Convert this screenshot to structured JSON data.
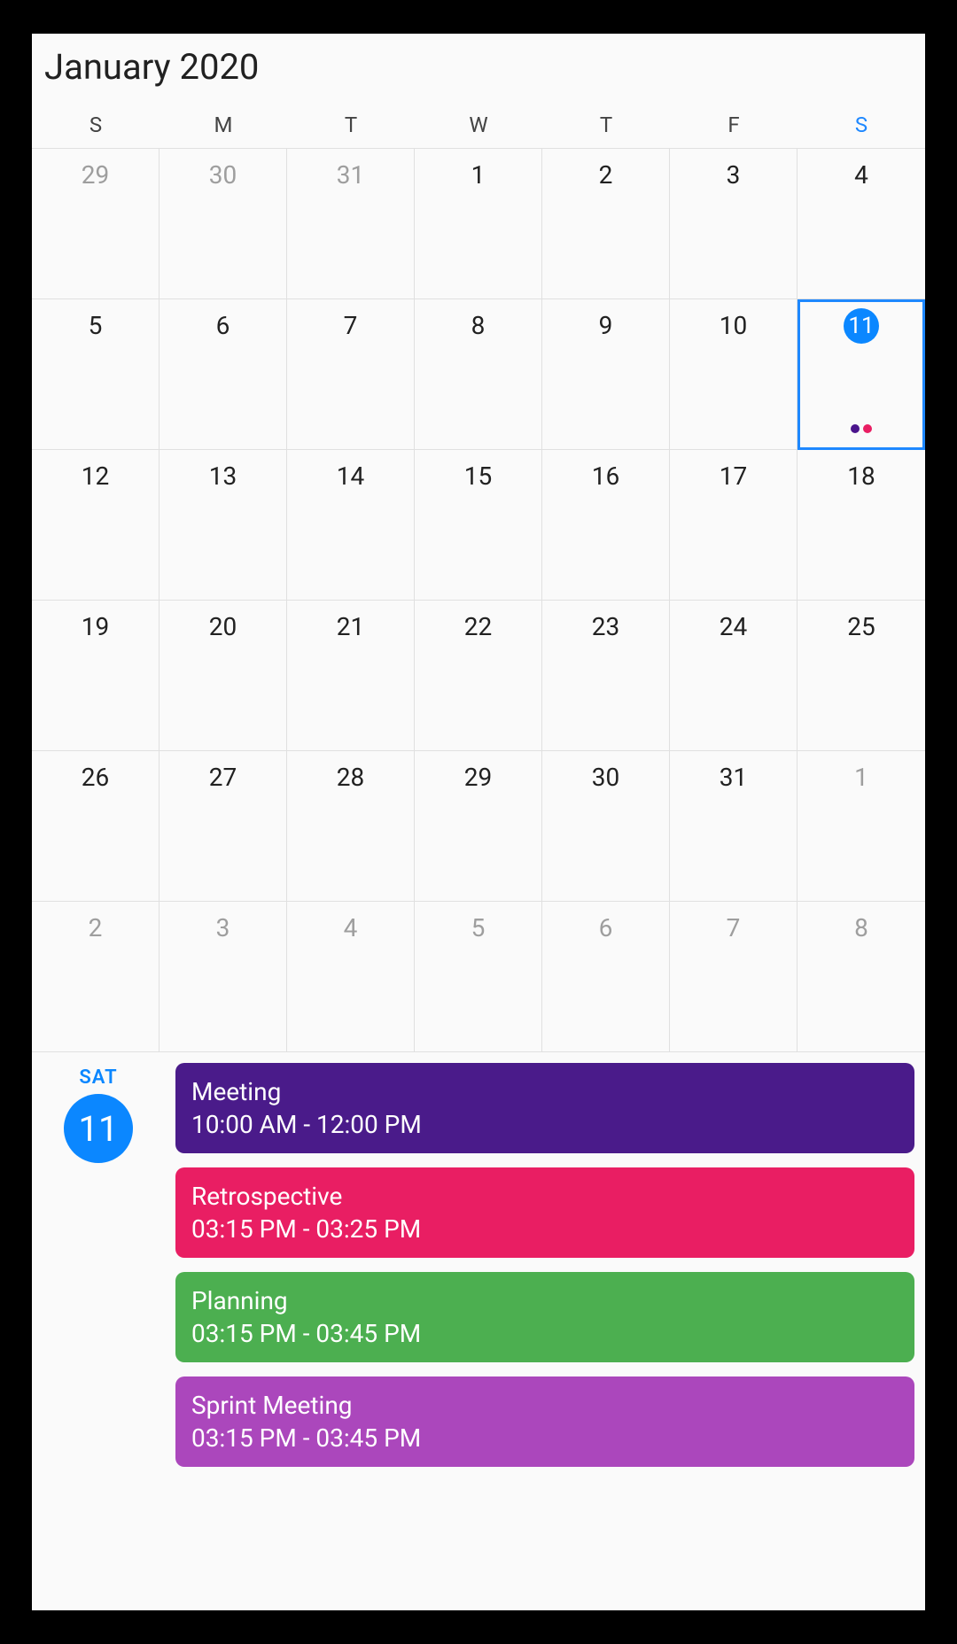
{
  "header": {
    "month_title": "January 2020"
  },
  "weekdays": [
    "S",
    "M",
    "T",
    "W",
    "T",
    "F",
    "S"
  ],
  "selected": {
    "dow": "SAT",
    "day": "11"
  },
  "grid": [
    {
      "n": "29",
      "out": true
    },
    {
      "n": "30",
      "out": true
    },
    {
      "n": "31",
      "out": true
    },
    {
      "n": "1"
    },
    {
      "n": "2"
    },
    {
      "n": "3"
    },
    {
      "n": "4"
    },
    {
      "n": "5"
    },
    {
      "n": "6"
    },
    {
      "n": "7"
    },
    {
      "n": "8"
    },
    {
      "n": "9"
    },
    {
      "n": "10"
    },
    {
      "n": "11",
      "selected": true,
      "today": true,
      "dots": [
        "#4a148c",
        "#e91e63"
      ]
    },
    {
      "n": "12"
    },
    {
      "n": "13"
    },
    {
      "n": "14"
    },
    {
      "n": "15"
    },
    {
      "n": "16"
    },
    {
      "n": "17"
    },
    {
      "n": "18"
    },
    {
      "n": "19"
    },
    {
      "n": "20"
    },
    {
      "n": "21"
    },
    {
      "n": "22"
    },
    {
      "n": "23"
    },
    {
      "n": "24"
    },
    {
      "n": "25"
    },
    {
      "n": "26"
    },
    {
      "n": "27"
    },
    {
      "n": "28"
    },
    {
      "n": "29"
    },
    {
      "n": "30"
    },
    {
      "n": "31"
    },
    {
      "n": "1",
      "out": true
    },
    {
      "n": "2",
      "out": true
    },
    {
      "n": "3",
      "out": true
    },
    {
      "n": "4",
      "out": true
    },
    {
      "n": "5",
      "out": true
    },
    {
      "n": "6",
      "out": true
    },
    {
      "n": "7",
      "out": true
    },
    {
      "n": "8",
      "out": true
    }
  ],
  "events": [
    {
      "title": "Meeting",
      "time": "10:00 AM - 12:00 PM",
      "color": "#4a1b8a"
    },
    {
      "title": "Retrospective",
      "time": "03:15 PM - 03:25 PM",
      "color": "#e91e63"
    },
    {
      "title": "Planning",
      "time": "03:15 PM - 03:45 PM",
      "color": "#4caf50"
    },
    {
      "title": "Sprint Meeting",
      "time": "03:15 PM - 03:45 PM",
      "color": "#ab47bc"
    }
  ]
}
